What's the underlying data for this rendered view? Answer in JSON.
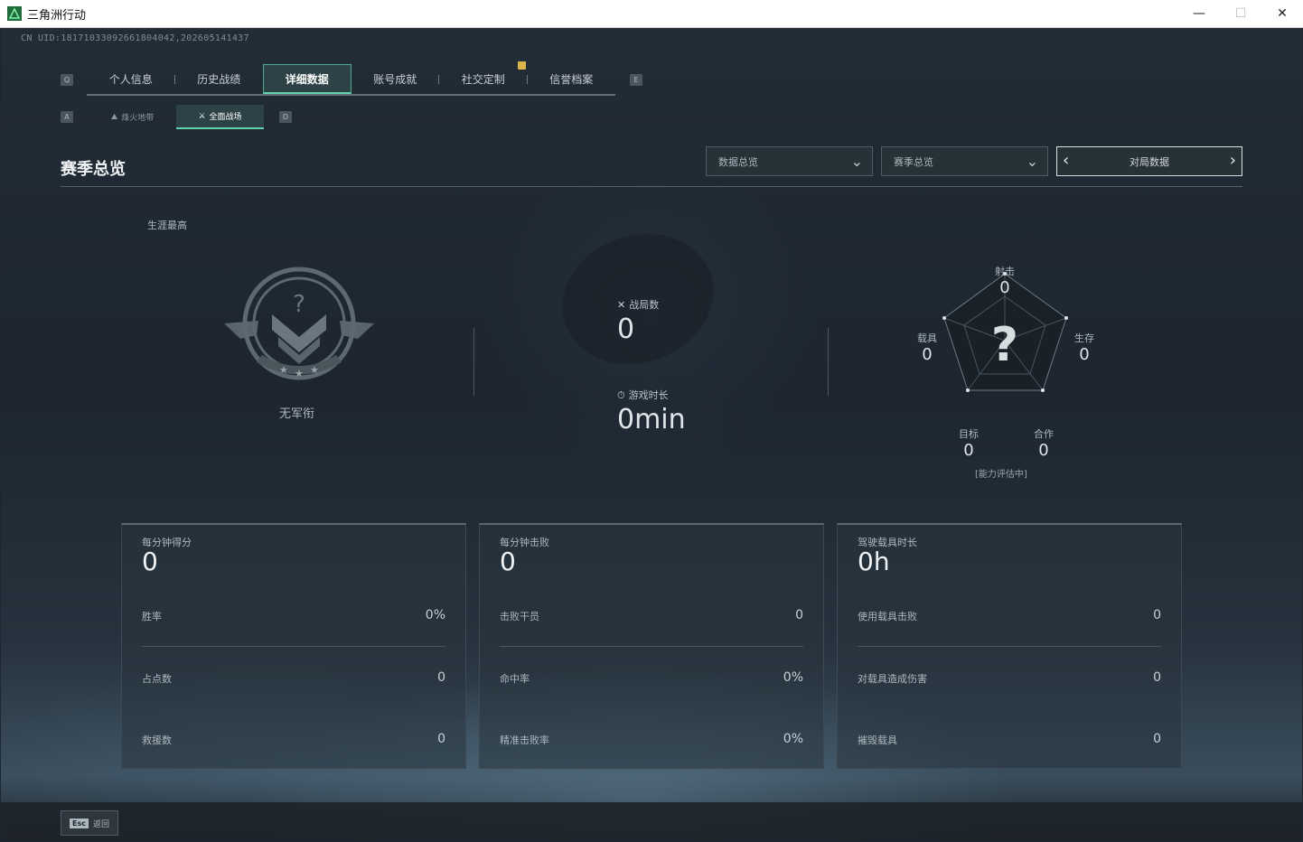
{
  "window": {
    "title": "三角洲行动",
    "minimize": "—",
    "maximize": "☐",
    "close": "✕"
  },
  "uid": "CN UID:18171033092661804042,202605141437",
  "main_tabs": {
    "prev_key": "Q",
    "next_key": "E",
    "items": [
      {
        "label": "个人信息",
        "active": false
      },
      {
        "label": "历史战绩",
        "active": false
      },
      {
        "label": "详细数据",
        "active": true
      },
      {
        "label": "账号成就",
        "active": false
      },
      {
        "label": "社交定制",
        "active": false
      },
      {
        "label": "信誉档案",
        "active": false
      }
    ]
  },
  "sub_tabs": {
    "prev_key": "A",
    "next_key": "D",
    "items": [
      {
        "label": "烽火地带",
        "active": false
      },
      {
        "label": "全面战场",
        "active": true
      }
    ]
  },
  "section": {
    "title": "赛季总览",
    "dropdown_data": "数据总览",
    "dropdown_season": "赛季总览",
    "pager_label": "对局数据"
  },
  "rank": {
    "career_label": "生涯最高",
    "name": "无军衔"
  },
  "summary": {
    "battles_label": "战局数",
    "battles_value": "0",
    "time_label": "游戏时长",
    "time_value": "0min"
  },
  "radar": {
    "shooting_label": "射击",
    "shooting_value": "0",
    "survival_label": "生存",
    "survival_value": "0",
    "coop_label": "合作",
    "coop_value": "0",
    "objective_label": "目标",
    "objective_value": "0",
    "vehicle_label": "载具",
    "vehicle_value": "0",
    "center_mark": "?",
    "note": "[能力评估中]"
  },
  "cards": [
    {
      "title": "每分钟得分",
      "value": "0",
      "rows": [
        {
          "label": "胜率",
          "value": "0%"
        },
        {
          "label": "占点数",
          "value": "0"
        },
        {
          "label": "救援数",
          "value": "0"
        }
      ]
    },
    {
      "title": "每分钟击败",
      "value": "0",
      "rows": [
        {
          "label": "击败干员",
          "value": "0"
        },
        {
          "label": "命中率",
          "value": "0%"
        },
        {
          "label": "精准击败率",
          "value": "0%"
        }
      ]
    },
    {
      "title": "驾驶载具时长",
      "value": "0h",
      "rows": [
        {
          "label": "使用载具击败",
          "value": "0"
        },
        {
          "label": "对载具造成伤害",
          "value": "0"
        },
        {
          "label": "摧毁载具",
          "value": "0"
        }
      ]
    }
  ],
  "footer": {
    "esc_key": "Esc",
    "back_label": "返回"
  },
  "colors": {
    "accent": "#5fd1ab",
    "notification": "#d9b54a"
  }
}
